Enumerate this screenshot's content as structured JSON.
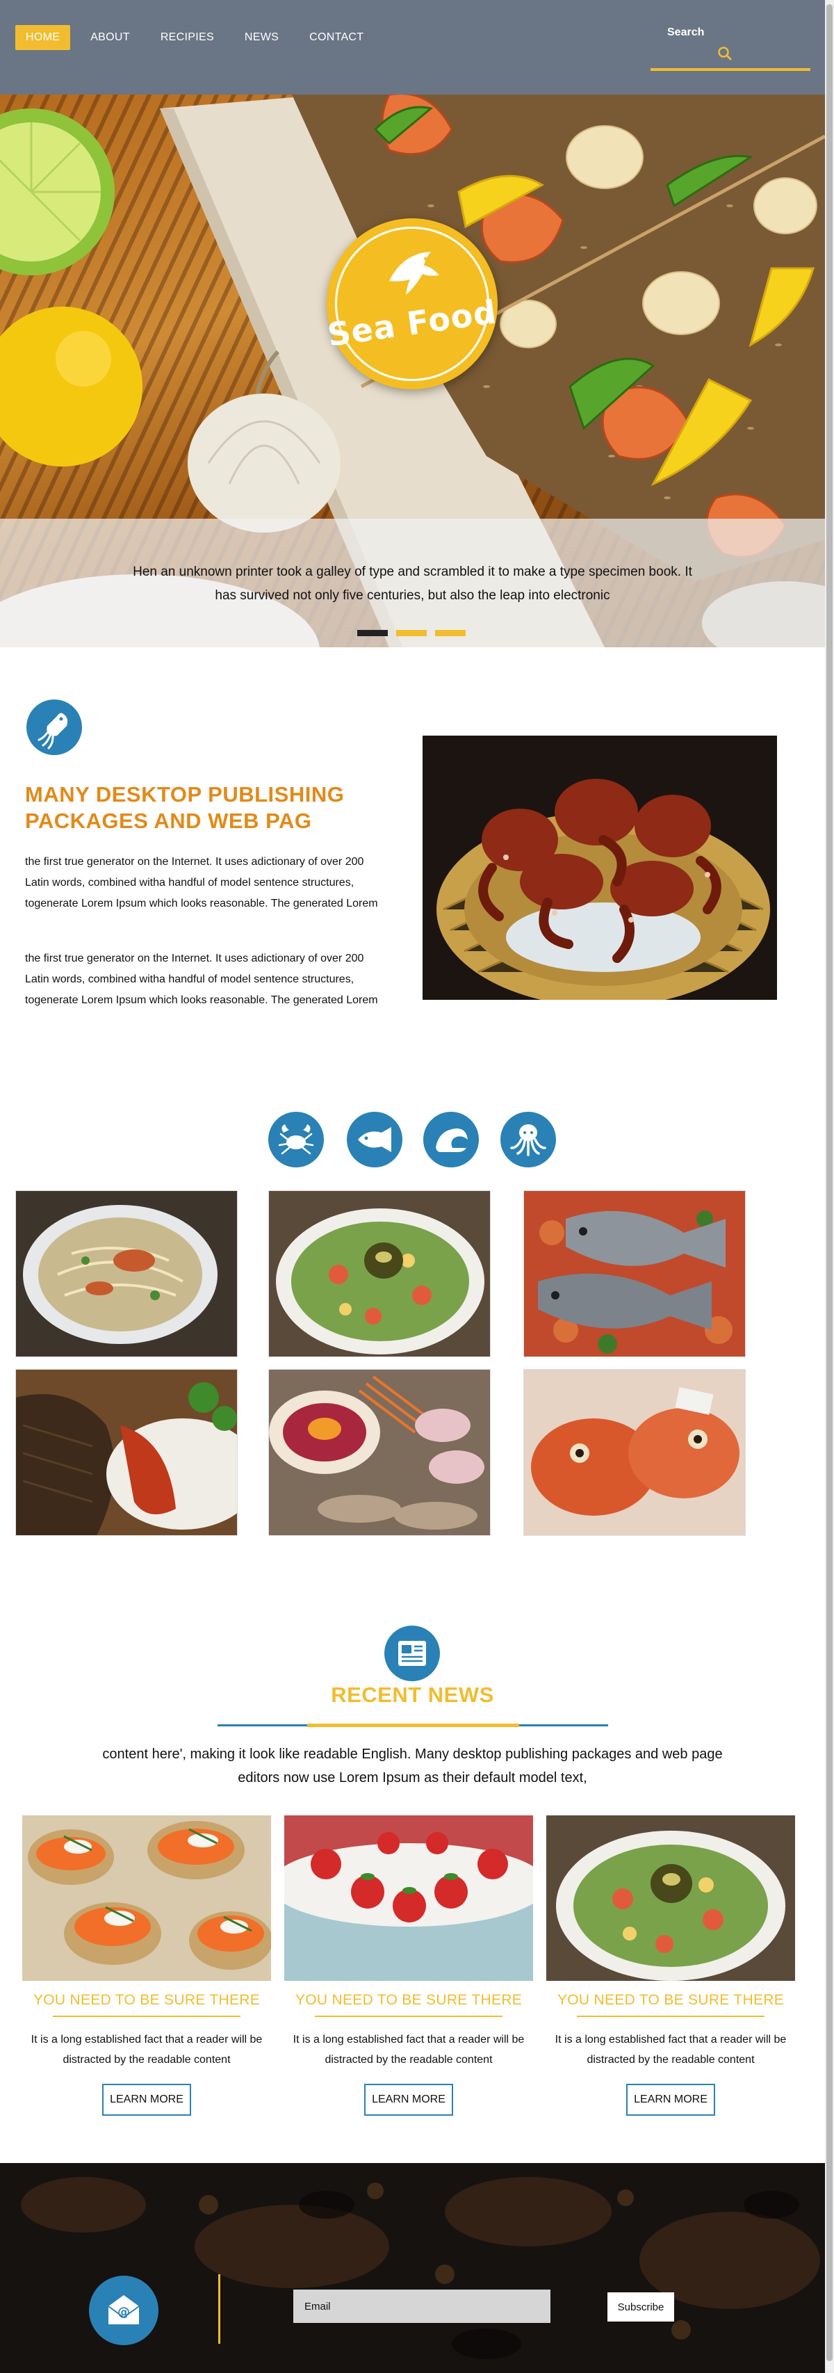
{
  "nav": {
    "items": [
      {
        "label": "HOME"
      },
      {
        "label": "ABOUT"
      },
      {
        "label": "RECIPIES"
      },
      {
        "label": "NEWS"
      },
      {
        "label": "CONTACT"
      }
    ],
    "active": "HOME"
  },
  "search": {
    "label": "Search",
    "placeholder": ""
  },
  "hero": {
    "logo_text": "Sea Food",
    "caption": "Hen an unknown printer took a galley of type and scrambled it to make a type specimen book. It has survived not only five centuries, but also the leap into electronic",
    "slides": 3,
    "active_slide": 1
  },
  "about": {
    "icon": "squid-icon",
    "title": "MANY DESKTOP PUBLISHING PACKAGES AND WEB PAG",
    "paragraphs": [
      "the first true generator on the Internet. It uses adictionary of over 200 Latin words, combined witha handful of model sentence structures, togenerate Lorem Ipsum which looks reasonable. The generated Lorem",
      "the first true generator on the Internet. It uses adictionary of over 200 Latin words, combined witha handful of model sentence structures, togenerate Lorem Ipsum which looks reasonable. The generated Lorem"
    ]
  },
  "categories": {
    "icons": [
      "crab-icon",
      "fish-icon",
      "shell-icon",
      "octopus-icon"
    ]
  },
  "news": {
    "icon": "newspaper-icon",
    "title": "RECENT NEWS",
    "intro": "content here', making it look like readable English. Many desktop publishing packages and web page editors now use Lorem Ipsum as their default model text,",
    "cards": [
      {
        "title": "YOU NEED TO BE SURE THERE",
        "text": "It is a long established fact that a reader will be distracted by the readable content",
        "button": "LEARN MORE"
      },
      {
        "title": "YOU NEED TO BE SURE THERE",
        "text": "It is a long established fact that a reader will be distracted by the readable content",
        "button": "LEARN MORE"
      },
      {
        "title": "YOU NEED TO BE SURE THERE",
        "text": "It is a long established fact that a reader will be distracted by the readable content",
        "button": "LEARN MORE"
      }
    ]
  },
  "footer": {
    "icon": "mail-icon",
    "email_placeholder": "Email",
    "subscribe_label": "Subscribe"
  },
  "colors": {
    "accent": "#f1bc2f",
    "blue": "#2a81b5",
    "header": "#6a7685",
    "title_orange": "#e28a1a"
  }
}
